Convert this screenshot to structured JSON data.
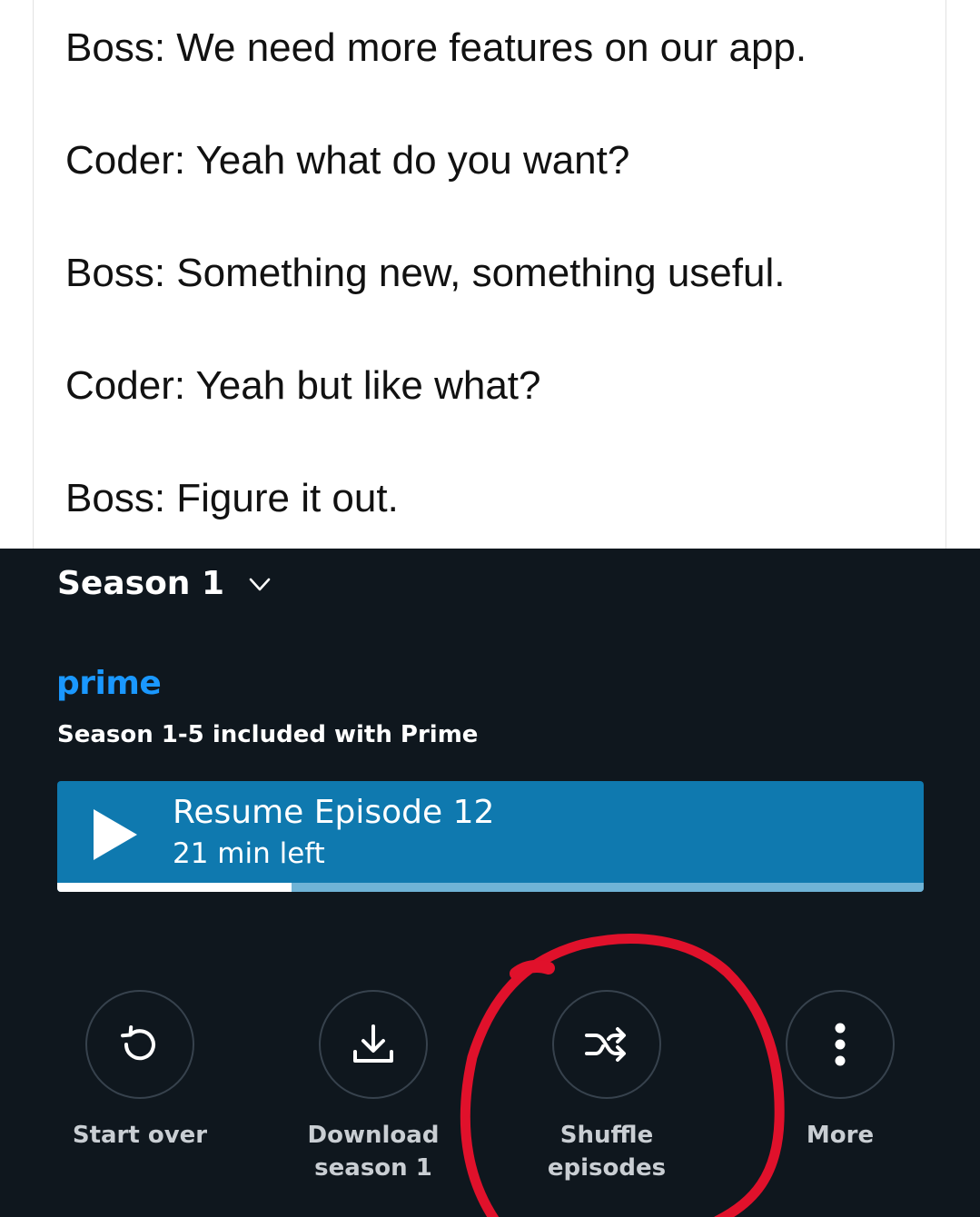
{
  "post": {
    "lines": [
      "Boss: We need more features on our app.",
      "Coder: Yeah what do you want?",
      "Boss: Something new, something useful.",
      "Coder: Yeah but like what?",
      "Boss: Figure it out."
    ]
  },
  "app": {
    "season_select": "Season 1",
    "prime_logo": "prime",
    "included_text": "Season 1-5 included with Prime",
    "resume": {
      "title": "Resume Episode 12",
      "subtitle": "21 min left",
      "progress": 0.27
    },
    "actions": [
      {
        "label": "Start over",
        "icon": "restart-icon"
      },
      {
        "label": "Download\nseason 1",
        "icon": "download-icon"
      },
      {
        "label": "Shuffle\nepisodes",
        "icon": "shuffle-icon"
      },
      {
        "label": "More",
        "icon": "more-dots-icon"
      }
    ],
    "colors": {
      "background": "#0f171e",
      "prime_blue": "#1a98ff",
      "resume_button": "#0f79af",
      "annotation_red": "#e0112b"
    }
  }
}
